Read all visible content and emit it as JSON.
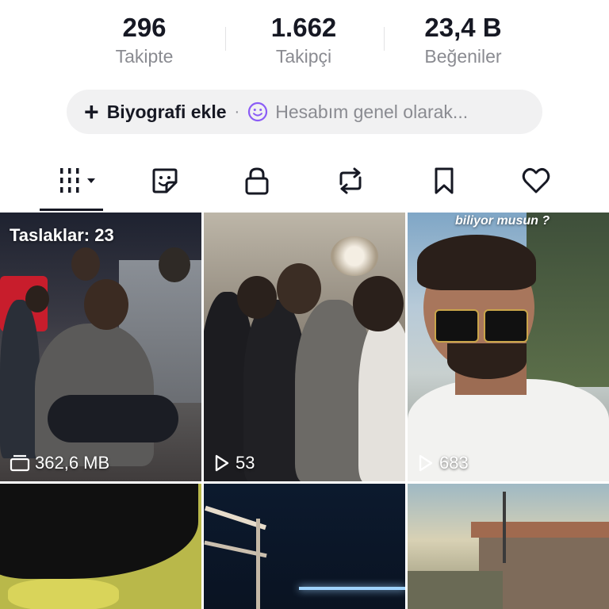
{
  "stats": [
    {
      "value": "296",
      "label": "Takipte"
    },
    {
      "value": "1.662",
      "label": "Takipçi"
    },
    {
      "value": "23,4 B",
      "label": "Beğeniler"
    }
  ],
  "bio": {
    "add_label": "Biyografi ekle",
    "separator": "·",
    "status_text": "Hesabım genel olarak..."
  },
  "tabs": [
    {
      "name": "videos",
      "icon": "grid-icon",
      "active": true
    },
    {
      "name": "stickers",
      "icon": "sticker-icon"
    },
    {
      "name": "private",
      "icon": "lock-icon"
    },
    {
      "name": "reposts",
      "icon": "repost-icon"
    },
    {
      "name": "favorites",
      "icon": "bookmark-icon"
    },
    {
      "name": "liked",
      "icon": "heart-icon"
    }
  ],
  "grid": {
    "drafts": {
      "label": "Taslaklar: 23",
      "size": "362,6 MB"
    },
    "video2": {
      "views": "53"
    },
    "video3": {
      "views": "683",
      "caption": "biliyor musun ?"
    }
  }
}
